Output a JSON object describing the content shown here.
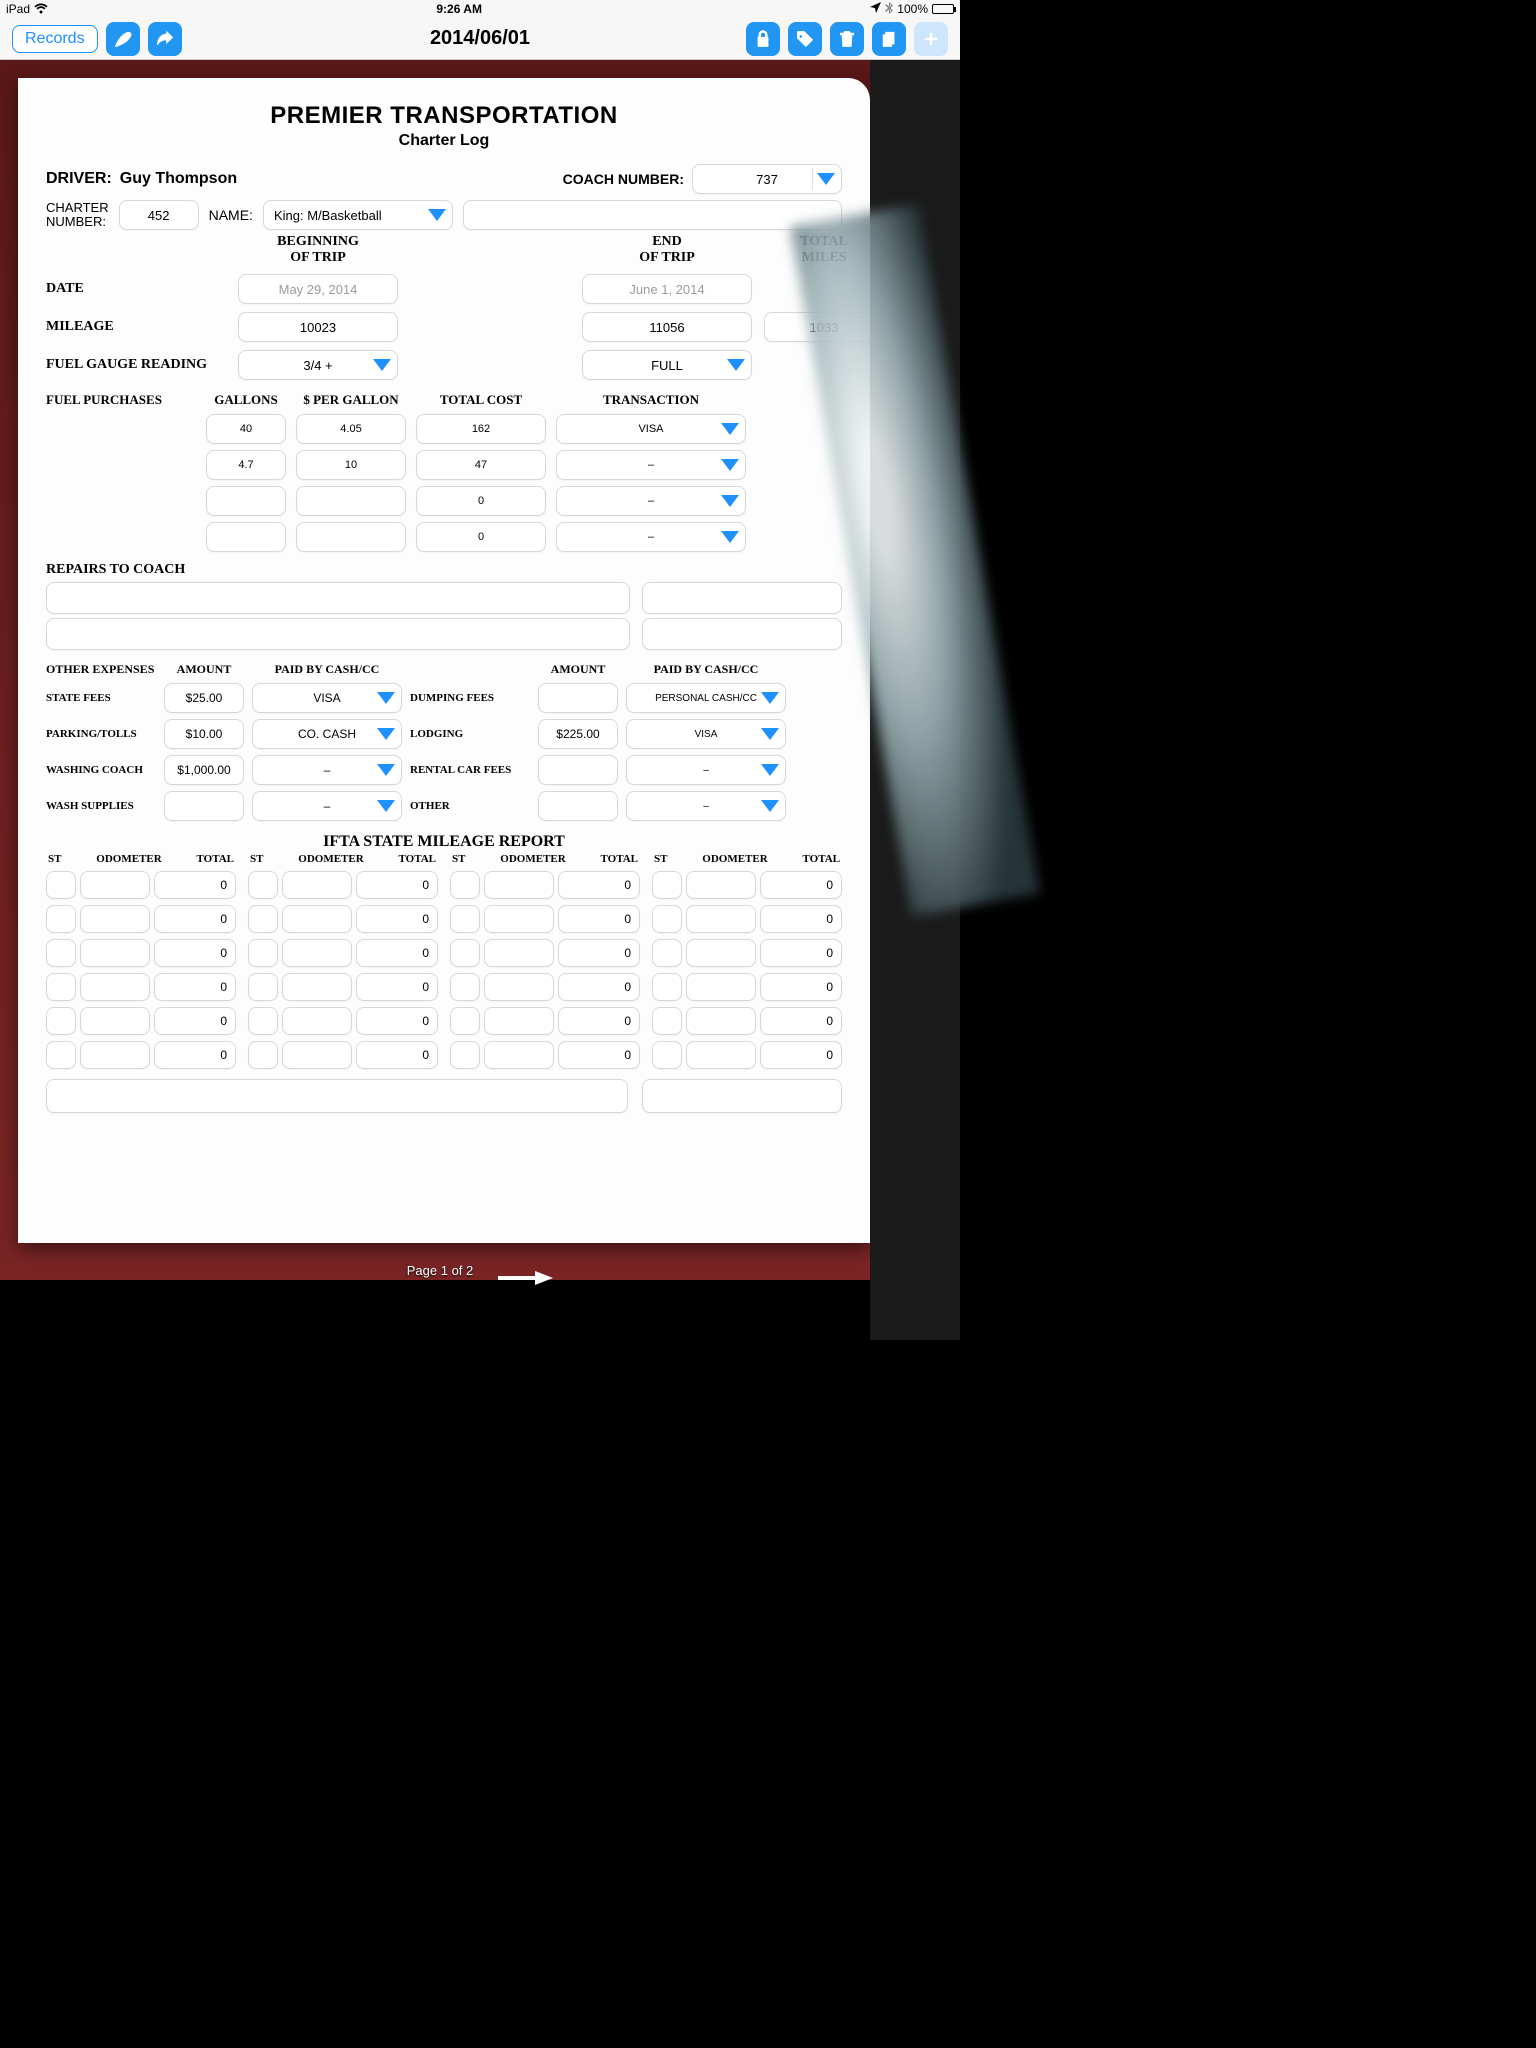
{
  "status": {
    "device": "iPad",
    "time": "9:26 AM",
    "battery": "100%"
  },
  "toolbar": {
    "records": "Records",
    "title": "2014/06/01"
  },
  "form": {
    "company": "PREMIER TRANSPORTATION",
    "subtitle": "Charter Log",
    "driver_label": "DRIVER:",
    "driver_name": "Guy Thompson",
    "coach_label": "COACH NUMBER:",
    "coach_number": "737",
    "charter_label_1": "CHARTER",
    "charter_label_2": "NUMBER:",
    "charter_number": "452",
    "name_label": "NAME:",
    "name_value": "King:  M/Basketball",
    "col_begin_1": "BEGINNING",
    "col_begin_2": "OF TRIP",
    "col_end_1": "END",
    "col_end_2": "OF TRIP",
    "col_total_1": "TOTAL",
    "col_total_2": "MILES",
    "date_label": "DATE",
    "date_begin": "May 29, 2014",
    "date_end": "June 1, 2014",
    "mileage_label": "MILEAGE",
    "mileage_begin": "10023",
    "mileage_end": "11056",
    "mileage_total": "1033",
    "fuel_gauge_label": "FUEL GAUGE READING",
    "fuel_gauge_begin": "3/4 +",
    "fuel_gauge_end": "FULL",
    "fuel_hdr": {
      "a": "FUEL PURCHASES",
      "b": "GALLONS",
      "c": "$ PER GALLON",
      "d": "TOTAL COST",
      "e": "TRANSACTION"
    },
    "fuel_rows": [
      {
        "gallons": "40",
        "ppg": "4.05",
        "total": "162",
        "txn": "VISA"
      },
      {
        "gallons": "4.7",
        "ppg": "10",
        "total": "47",
        "txn": "–"
      },
      {
        "gallons": "",
        "ppg": "",
        "total": "0",
        "txn": "–"
      },
      {
        "gallons": "",
        "ppg": "",
        "total": "0",
        "txn": "–"
      }
    ],
    "repairs_label": "REPAIRS TO COACH",
    "exp_hdr": {
      "a": "OTHER EXPENSES",
      "b": "AMOUNT",
      "c": "PAID BY CASH/CC",
      "d": "",
      "e": "AMOUNT",
      "f": "PAID BY CASH/CC"
    },
    "exp_rows": [
      {
        "l": "STATE FEES",
        "amt": "$25.00",
        "pay": "VISA",
        "r": "DUMPING FEES",
        "ramt": "",
        "rpay": "PERSONAL CASH/CC"
      },
      {
        "l": "PARKING/TOLLS",
        "amt": "$10.00",
        "pay": "CO. CASH",
        "r": "LODGING",
        "ramt": "$225.00",
        "rpay": "VISA"
      },
      {
        "l": "WASHING COACH",
        "amt": "$1,000.00",
        "pay": "–",
        "r": "RENTAL CAR FEES",
        "ramt": "",
        "rpay": "–"
      },
      {
        "l": "WASH SUPPLIES",
        "amt": "",
        "pay": "–",
        "r": "OTHER",
        "ramt": "",
        "rpay": "–"
      }
    ],
    "ifta_title": "IFTA STATE MILEAGE REPORT",
    "ifta_head": {
      "st": "ST",
      "odo": "ODOMETER",
      "tot": "TOTAL"
    },
    "ifta_zero": "0",
    "page_indicator": "Page 1 of 2"
  }
}
